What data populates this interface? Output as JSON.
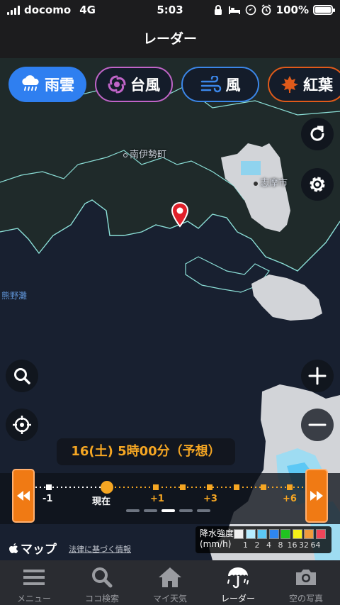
{
  "status_bar": {
    "carrier": "docomo",
    "network": "4G",
    "time": "5:03",
    "battery": "100%",
    "battery_level": 1.0
  },
  "title": "レーダー",
  "layer_chips": [
    {
      "label": "雨雲",
      "active": true,
      "color": "#2f7ff0"
    },
    {
      "label": "台風",
      "active": false,
      "color": "#c064c8"
    },
    {
      "label": "風",
      "active": false,
      "color": "#3b86e8"
    },
    {
      "label": "紅葉",
      "active": false,
      "color": "#e05a1a"
    }
  ],
  "map": {
    "places": [
      {
        "name": "南伊勢町"
      },
      {
        "name": "志摩市"
      }
    ],
    "sea": "熊野灘",
    "attribution": "マップ",
    "legal_link": "法律に基づく情報"
  },
  "timeline": {
    "date_label": "16(土) 5時00分（予想）",
    "ticks": [
      "-1",
      "現在",
      "+1",
      "+3",
      "+6"
    ],
    "accent_color": "#f5a623",
    "pages": 5,
    "active_page": 3
  },
  "legend": {
    "title_line1": "降水強度",
    "title_line2": "(mm/h)",
    "values": [
      "1",
      "2",
      "4",
      "8",
      "16",
      "32",
      "64"
    ],
    "colors": [
      "#f0f0f0",
      "#b6ecff",
      "#5cc8f5",
      "#2e86f0",
      "#1fc41f",
      "#f5f018",
      "#f09a3c",
      "#f0455a"
    ]
  },
  "tabs": [
    {
      "label": "メニュー",
      "icon": "menu-icon",
      "active": false
    },
    {
      "label": "ココ検索",
      "icon": "search-icon",
      "active": false
    },
    {
      "label": "マイ天気",
      "icon": "home-icon",
      "active": false
    },
    {
      "label": "レーダー",
      "icon": "radar-umbrella-icon",
      "active": true
    },
    {
      "label": "空の写真",
      "icon": "camera-icon",
      "active": false
    }
  ]
}
